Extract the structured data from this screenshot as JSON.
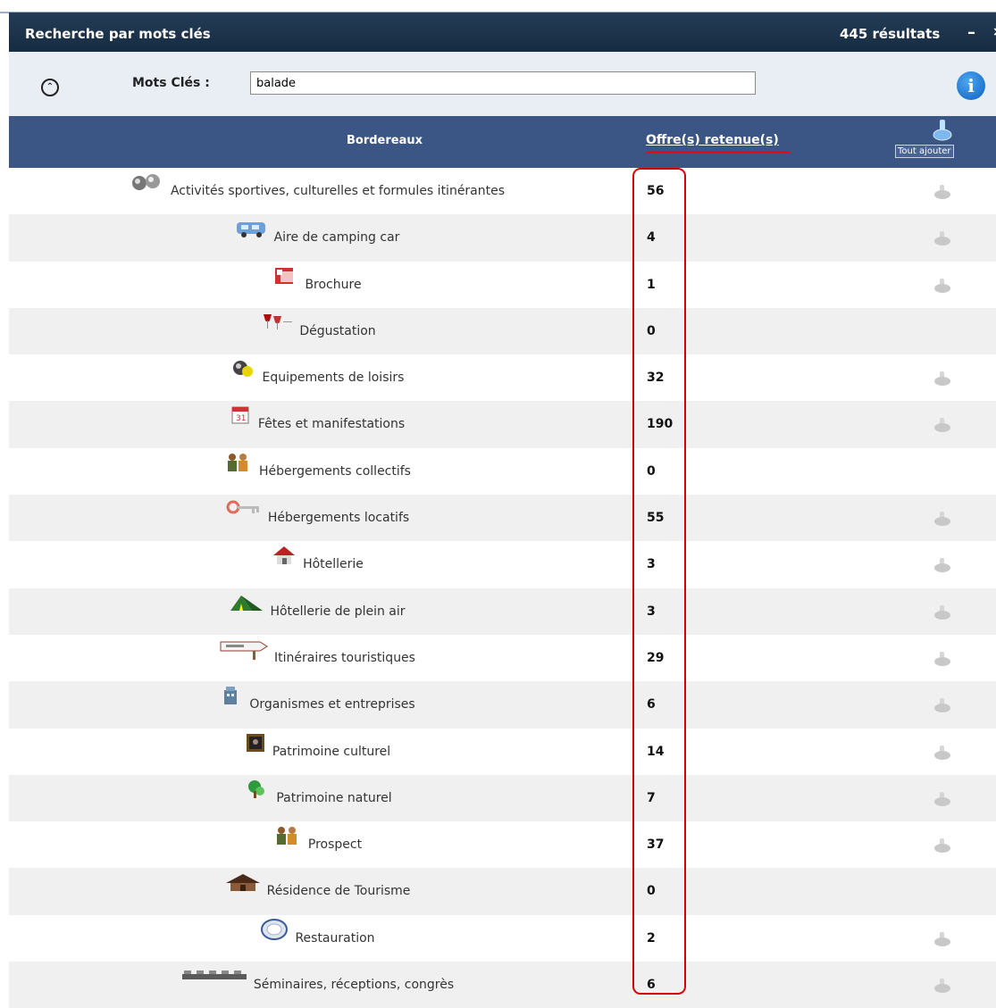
{
  "window": {
    "title": "Recherche par mots clés",
    "result_count": "445 résultats",
    "minimize": "–",
    "close": "×"
  },
  "search": {
    "label": "Mots Clés :",
    "value": "balade",
    "collapse": "^",
    "info": "i"
  },
  "table": {
    "col_name": "Bordereaux",
    "col_offers": "Offre(s) retenue(s)",
    "add_all": "Tout ajouter",
    "rows": [
      {
        "label": "Activités sportives, culturelles et formules itinérantes",
        "count": "56",
        "icon": "balls-icon",
        "add": true
      },
      {
        "label": "Aire de camping car",
        "count": "4",
        "icon": "camping-car-icon",
        "add": true
      },
      {
        "label": "Brochure",
        "count": "1",
        "icon": "brochure-icon",
        "add": true
      },
      {
        "label": "Dégustation",
        "count": "0",
        "icon": "wine-glasses-icon",
        "add": false
      },
      {
        "label": "Equipements de loisirs",
        "count": "32",
        "icon": "leisure-balls-icon",
        "add": true
      },
      {
        "label": "Fêtes et manifestations",
        "count": "190",
        "icon": "calendar-icon",
        "add": true
      },
      {
        "label": "Hébergements collectifs",
        "count": "0",
        "icon": "people-icon",
        "add": false
      },
      {
        "label": "Hébergements locatifs",
        "count": "55",
        "icon": "key-icon",
        "add": true
      },
      {
        "label": "Hôtellerie",
        "count": "3",
        "icon": "house-icon",
        "add": true
      },
      {
        "label": "Hôtellerie de plein air",
        "count": "3",
        "icon": "tent-icon",
        "add": true
      },
      {
        "label": "Itinéraires touristiques",
        "count": "29",
        "icon": "signpost-icon",
        "add": true
      },
      {
        "label": "Organismes et entreprises",
        "count": "6",
        "icon": "office-icon",
        "add": true
      },
      {
        "label": "Patrimoine culturel",
        "count": "14",
        "icon": "painting-icon",
        "add": true
      },
      {
        "label": "Patrimoine naturel",
        "count": "7",
        "icon": "nature-icon",
        "add": true
      },
      {
        "label": "Prospect",
        "count": "37",
        "icon": "people-icon",
        "add": true
      },
      {
        "label": "Résidence de Tourisme",
        "count": "0",
        "icon": "chalet-icon",
        "add": false
      },
      {
        "label": "Restauration",
        "count": "2",
        "icon": "plate-icon",
        "add": true
      },
      {
        "label": "Séminaires, réceptions, congrès",
        "count": "6",
        "icon": "conference-table-icon",
        "add": true
      }
    ]
  },
  "colors": {
    "titlebar": "#1c3349",
    "header": "#3b5685",
    "highlight": "#d80000"
  }
}
